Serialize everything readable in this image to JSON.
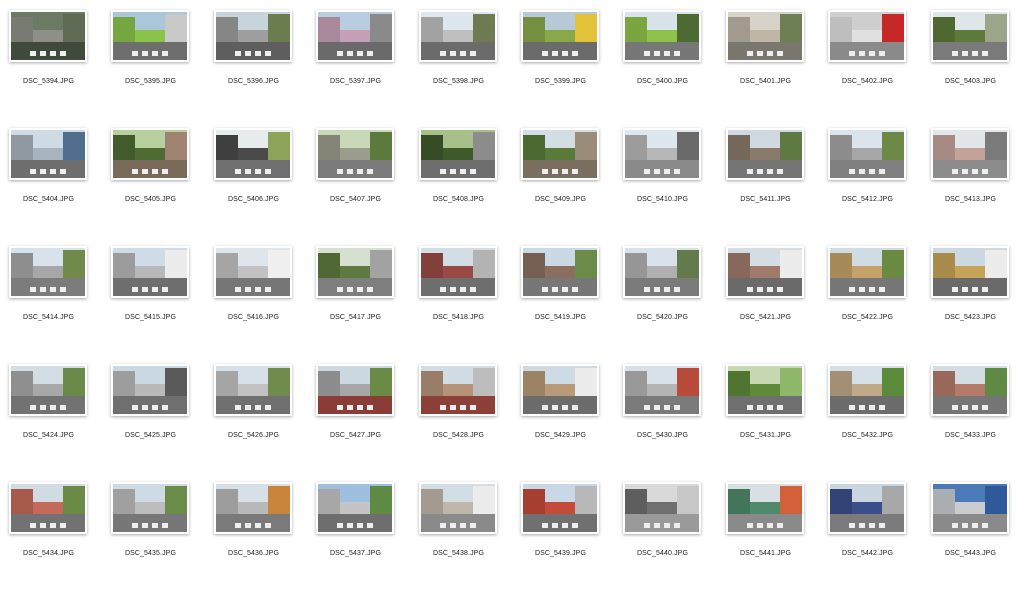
{
  "files": [
    {
      "name": "DSC_5394.JPG",
      "palette": [
        "#6d7a63",
        "#3f4a3a",
        "#8d8f88",
        "#5f6b55"
      ]
    },
    {
      "name": "DSC_5395.JPG",
      "palette": [
        "#a9c7d9",
        "#6e6e6e",
        "#8bc34a",
        "#c9c9c9"
      ]
    },
    {
      "name": "DSC_5396.JPG",
      "palette": [
        "#c7d4dc",
        "#5e5e5e",
        "#9e9e9e",
        "#6b7c4f"
      ]
    },
    {
      "name": "DSC_5397.JPG",
      "palette": [
        "#b9cde0",
        "#6a6a6a",
        "#c6a0b6",
        "#8a8a8a"
      ]
    },
    {
      "name": "DSC_5398.JPG",
      "palette": [
        "#dfe7ee",
        "#6b6b6b",
        "#bfbfbf",
        "#6d7a52"
      ]
    },
    {
      "name": "DSC_5399.JPG",
      "palette": [
        "#b7c9d6",
        "#6b6b6b",
        "#89a84a",
        "#e3c23a"
      ]
    },
    {
      "name": "DSC_5400.JPG",
      "palette": [
        "#d9e3ea",
        "#777777",
        "#8fc24a",
        "#4d6a32"
      ]
    },
    {
      "name": "DSC_5401.JPG",
      "palette": [
        "#d8d3c8",
        "#7a776f",
        "#bfb6a6",
        "#6e7f56"
      ]
    },
    {
      "name": "DSC_5402.JPG",
      "palette": [
        "#cfcfcf",
        "#8a8a8a",
        "#e0e0e0",
        "#c62828"
      ]
    },
    {
      "name": "DSC_5403.JPG",
      "palette": [
        "#dfe6ea",
        "#7a7a7a",
        "#5d7a3a",
        "#9aa58a"
      ]
    },
    {
      "name": "DSC_5404.JPG",
      "palette": [
        "#cfdbe4",
        "#6e6e6e",
        "#a7b4bf",
        "#4f6d8c"
      ]
    },
    {
      "name": "DSC_5405.JPG",
      "palette": [
        "#b8cfa0",
        "#7a6a5a",
        "#4d6b32",
        "#a08270"
      ]
    },
    {
      "name": "DSC_5406.JPG",
      "palette": [
        "#e6ebee",
        "#6f6f6f",
        "#4a4a4a",
        "#8ea35a"
      ]
    },
    {
      "name": "DSC_5407.JPG",
      "palette": [
        "#c9d8b7",
        "#7b7b7b",
        "#9c9c8c",
        "#5c7a3c"
      ]
    },
    {
      "name": "DSC_5408.JPG",
      "palette": [
        "#a7c08a",
        "#6e6e6e",
        "#3f5a2a",
        "#8c8c8c"
      ]
    },
    {
      "name": "DSC_5409.JPG",
      "palette": [
        "#d2dde4",
        "#7a6e60",
        "#5a7a3a",
        "#9a8c78"
      ]
    },
    {
      "name": "DSC_5410.JPG",
      "palette": [
        "#dfe7ee",
        "#8a8a8a",
        "#b7b7b7",
        "#6a6a6a"
      ]
    },
    {
      "name": "DSC_5411.JPG",
      "palette": [
        "#cfd9df",
        "#757575",
        "#8a7a6a",
        "#5e7a42"
      ]
    },
    {
      "name": "DSC_5412.JPG",
      "palette": [
        "#dbe4ea",
        "#808080",
        "#a6a6a6",
        "#6c8a46"
      ]
    },
    {
      "name": "DSC_5413.JPG",
      "palette": [
        "#e2e6e8",
        "#8c8c8c",
        "#c3a29a",
        "#7a7a7a"
      ]
    },
    {
      "name": "DSC_5414.JPG",
      "palette": [
        "#d7e2ea",
        "#7c7c7c",
        "#a7a7a7",
        "#6f8a4a"
      ]
    },
    {
      "name": "DSC_5415.JPG",
      "palette": [
        "#cfdbe6",
        "#6e6e6e",
        "#b8b8b8",
        "#ececec"
      ]
    },
    {
      "name": "DSC_5416.JPG",
      "palette": [
        "#dfe6eb",
        "#767676",
        "#c2c2c2",
        "#f0f0f0"
      ]
    },
    {
      "name": "DSC_5417.JPG",
      "palette": [
        "#d6e0d0",
        "#7e7e7e",
        "#5d7a40",
        "#a3a3a3"
      ]
    },
    {
      "name": "DSC_5418.JPG",
      "palette": [
        "#d3dde6",
        "#6e6e6e",
        "#9a4a44",
        "#b3b3b3"
      ]
    },
    {
      "name": "DSC_5419.JPG",
      "palette": [
        "#c9d9e6",
        "#777777",
        "#8a6e60",
        "#6c8a48"
      ]
    },
    {
      "name": "DSC_5420.JPG",
      "palette": [
        "#d9e2ea",
        "#7a7a7a",
        "#b0b0b0",
        "#637a4c"
      ]
    },
    {
      "name": "DSC_5421.JPG",
      "palette": [
        "#d4dde4",
        "#6a6a6a",
        "#a07a6a",
        "#ececec"
      ]
    },
    {
      "name": "DSC_5422.JPG",
      "palette": [
        "#d0dbe3",
        "#777777",
        "#c4a26a",
        "#6a8a44"
      ]
    },
    {
      "name": "DSC_5423.JPG",
      "palette": [
        "#cdd9e2",
        "#6a6a6a",
        "#c7a35a",
        "#ececec"
      ]
    },
    {
      "name": "DSC_5424.JPG",
      "palette": [
        "#d3dde4",
        "#727272",
        "#a8a8a8",
        "#6a8a4a"
      ]
    },
    {
      "name": "DSC_5425.JPG",
      "palette": [
        "#cbd9e4",
        "#6f6f6f",
        "#b9b9b9",
        "#5a5a5a"
      ]
    },
    {
      "name": "DSC_5426.JPG",
      "palette": [
        "#d6e0e8",
        "#707070",
        "#c2c2c2",
        "#6f8c4c"
      ]
    },
    {
      "name": "DSC_5427.JPG",
      "palette": [
        "#cdd9e2",
        "#8a3c36",
        "#a6a6a6",
        "#6a8a46"
      ]
    },
    {
      "name": "DSC_5428.JPG",
      "palette": [
        "#d2dce4",
        "#8c4038",
        "#b4937a",
        "#bdbdbd"
      ]
    },
    {
      "name": "DSC_5429.JPG",
      "palette": [
        "#cfdbe4",
        "#6c6c6c",
        "#b99a78",
        "#ececec"
      ]
    },
    {
      "name": "DSC_5430.JPG",
      "palette": [
        "#d8e1e8",
        "#7a7a7a",
        "#b4b4b4",
        "#b84a3a"
      ]
    },
    {
      "name": "DSC_5431.JPG",
      "palette": [
        "#c8d8b2",
        "#6f6f6f",
        "#5e8a3a",
        "#8fb86a"
      ]
    },
    {
      "name": "DSC_5432.JPG",
      "palette": [
        "#d5dfe6",
        "#6c6c6c",
        "#c0a888",
        "#5a8a3a"
      ]
    },
    {
      "name": "DSC_5433.JPG",
      "palette": [
        "#d3dde4",
        "#757575",
        "#b37a6a",
        "#5e8a44"
      ]
    },
    {
      "name": "DSC_5434.JPG",
      "palette": [
        "#d0dbe3",
        "#727272",
        "#c46a5a",
        "#6a8a46"
      ]
    },
    {
      "name": "DSC_5435.JPG",
      "palette": [
        "#cfdbe4",
        "#777777",
        "#bcbcbc",
        "#6b8c48"
      ]
    },
    {
      "name": "DSC_5436.JPG",
      "palette": [
        "#d7e0e6",
        "#7a7a7a",
        "#b9b9b9",
        "#c8843a"
      ]
    },
    {
      "name": "DSC_5437.JPG",
      "palette": [
        "#9fbfe0",
        "#6e6e6e",
        "#c4c4c4",
        "#5e8a44"
      ]
    },
    {
      "name": "DSC_5438.JPG",
      "palette": [
        "#d3dde4",
        "#8a8a8a",
        "#c0b6aa",
        "#ececec"
      ]
    },
    {
      "name": "DSC_5439.JPG",
      "palette": [
        "#c8d8e6",
        "#707070",
        "#c44a3a",
        "#b8b8b8"
      ]
    },
    {
      "name": "DSC_5440.JPG",
      "palette": [
        "#d9d9d9",
        "#9a9a9a",
        "#6f6f6f",
        "#c8c8c8"
      ]
    },
    {
      "name": "DSC_5441.JPG",
      "palette": [
        "#d8e0e4",
        "#8a8a8a",
        "#4f8a6a",
        "#d4603a"
      ]
    },
    {
      "name": "DSC_5442.JPG",
      "palette": [
        "#c9d6e0",
        "#7b7b7b",
        "#3a4e8a",
        "#a8a8a8"
      ]
    },
    {
      "name": "DSC_5443.JPG",
      "palette": [
        "#4a7ab8",
        "#8a8a8a",
        "#c9cdd2",
        "#2f5a9a"
      ]
    }
  ]
}
